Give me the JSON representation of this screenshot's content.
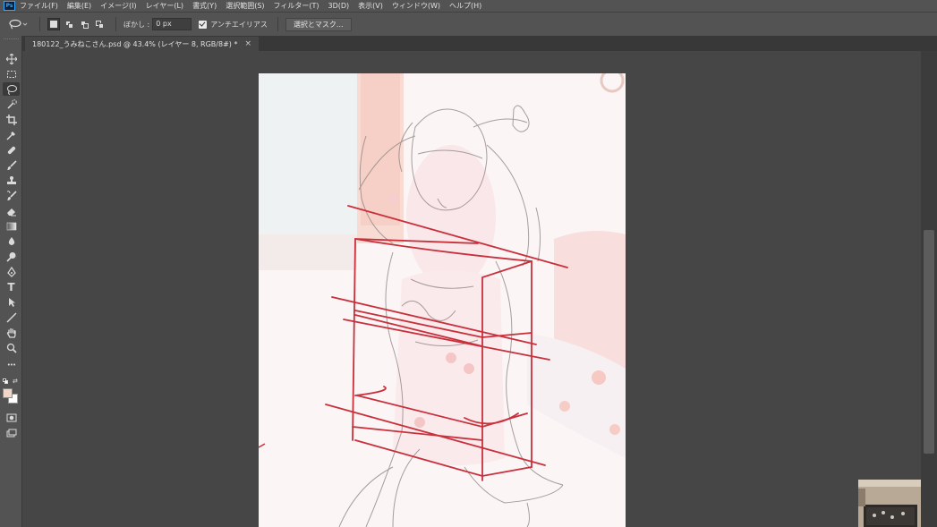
{
  "app": {
    "logo_text": "Ps"
  },
  "menu": [
    "ファイル(F)",
    "編集(E)",
    "イメージ(I)",
    "レイヤー(L)",
    "書式(Y)",
    "選択範囲(S)",
    "フィルター(T)",
    "3D(D)",
    "表示(V)",
    "ウィンドウ(W)",
    "ヘルプ(H)"
  ],
  "options": {
    "feather_label": "ぼかし :",
    "feather_value": "0 px",
    "antialias_label": "アンチエイリアス",
    "select_mask_label": "選択とマスク..."
  },
  "document": {
    "tab_title": "180122_うみねこさん.psd @ 43.4% (レイヤー 8, RGB/8#) *",
    "close_glyph": "×"
  },
  "tools": [
    "move-icon",
    "marquee-icon",
    "lasso-icon",
    "quick-select-icon",
    "crop-icon",
    "eyedropper-icon",
    "healing-icon",
    "brush-icon",
    "stamp-icon",
    "history-brush-icon",
    "eraser-icon",
    "gradient-icon",
    "blur-icon",
    "dodge-icon",
    "pen-icon",
    "type-icon",
    "path-select-icon",
    "line-icon",
    "hand-icon",
    "zoom-icon",
    "more-icon"
  ],
  "type_tool_glyph": "T",
  "more_glyph": "•••",
  "colors": {
    "foreground": "#f0d6c8",
    "background": "#ffffff",
    "guide_lines": "#c8303c",
    "sketch": "#8a8080"
  }
}
